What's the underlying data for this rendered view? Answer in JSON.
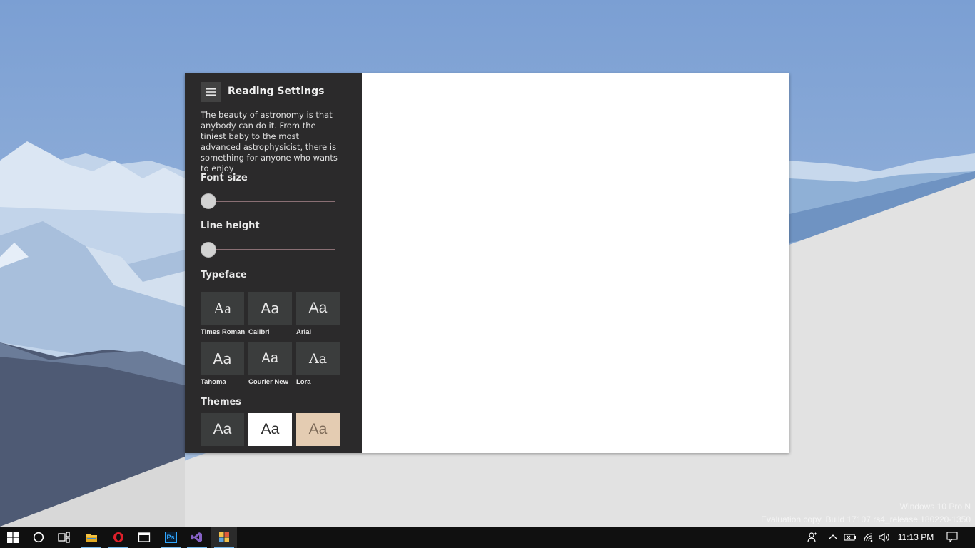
{
  "watermark": {
    "line1": "Windows 10 Pro N",
    "line2": "Evaluation copy. Build 17107.rs4_release.180220-1350"
  },
  "settings": {
    "title": "Reading Settings",
    "sample_text": "The beauty of astronomy is that anybody can do it. From the tiniest baby to the most advanced astrophysicist, there is something for anyone who wants to enjoy",
    "font_size": {
      "label": "Font size",
      "value_fraction": 0.0
    },
    "line_height": {
      "label": "Line height",
      "value_fraction": 0.0
    },
    "typeface": {
      "label": "Typeface",
      "options": [
        {
          "preview": "Aa",
          "name": "Times Roman"
        },
        {
          "preview": "Aa",
          "name": "Calibri"
        },
        {
          "preview": "Aa",
          "name": "Arial"
        },
        {
          "preview": "Aa",
          "name": "Tahoma"
        },
        {
          "preview": "Aa",
          "name": "Courier New"
        },
        {
          "preview": "Aa",
          "name": "Lora"
        }
      ]
    },
    "themes": {
      "label": "Themes",
      "options": [
        {
          "preview": "Aa",
          "bg": "#3b3d3d",
          "fg": "#e8e8e8"
        },
        {
          "preview": "Aa",
          "bg": "#ffffff",
          "fg": "#2b2b2b"
        },
        {
          "preview": "Aa",
          "bg": "#e4ccb2",
          "fg": "#7d6a58"
        }
      ]
    }
  },
  "taskbar": {
    "pinned": [
      "start-icon",
      "cortana-icon",
      "task-view-icon",
      "file-explorer-icon",
      "opera-icon",
      "window-app-icon",
      "photoshop-icon",
      "visual-studio-icon",
      "reading-app-icon"
    ],
    "photoshop_label": "Ps",
    "clock": "11:13 PM"
  },
  "colors": {
    "pane_bg": "#2b2a2b",
    "slider_track": "#8a6f74",
    "taskbar_bg": "#101010",
    "accent": "#76b9ed"
  }
}
